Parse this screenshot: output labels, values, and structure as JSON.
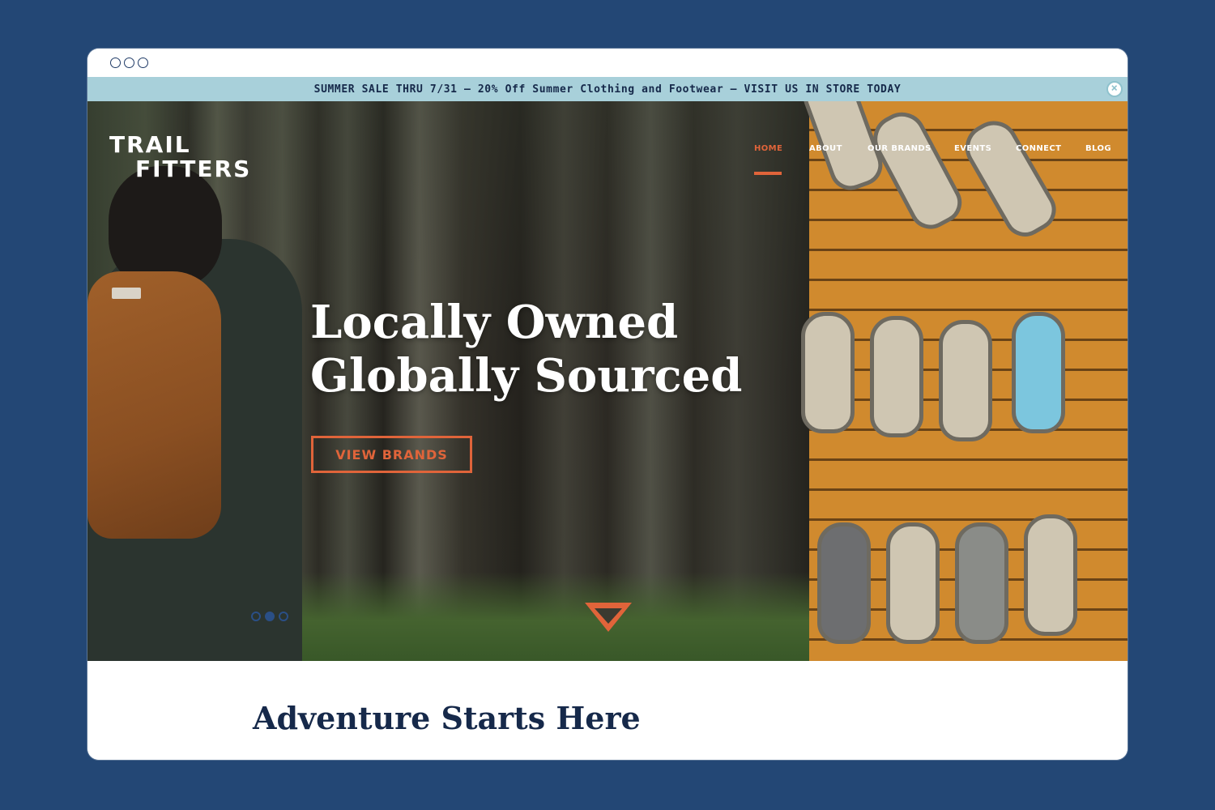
{
  "promo": {
    "text": "SUMMER SALE THRU 7/31 — 20% Off Summer Clothing and Footwear — VISIT US IN STORE TODAY",
    "close_icon": "close-icon"
  },
  "logo": {
    "line1": "TRAIL",
    "line2": "FITTERS"
  },
  "nav": {
    "items": [
      {
        "label": "HOME",
        "active": true
      },
      {
        "label": "ABOUT",
        "active": false
      },
      {
        "label": "OUR BRANDS",
        "active": false
      },
      {
        "label": "EVENTS",
        "active": false
      },
      {
        "label": "CONNECT",
        "active": false
      },
      {
        "label": "BLOG",
        "active": false
      }
    ]
  },
  "hero": {
    "headline_line1": "Locally Owned",
    "headline_line2": "Globally Sourced",
    "cta_label": "VIEW BRANDS",
    "carousel_active_index": 1,
    "carousel_count": 3
  },
  "section": {
    "title": "Adventure Starts Here"
  },
  "colors": {
    "page_bg": "#234775",
    "accent": "#e0643a",
    "promo_bg": "#a8d0da",
    "navy": "#16294a"
  }
}
